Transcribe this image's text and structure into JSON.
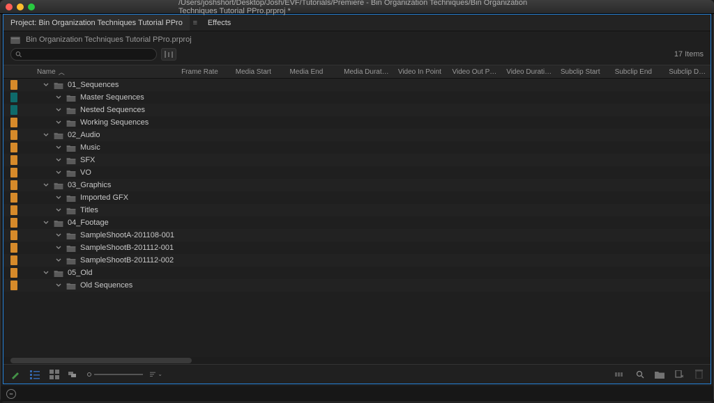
{
  "window": {
    "title": "/Users/joshshort/Desktop/Josh/EVF/Tutorials/Premiere - Bin Organization Techniques/Bin Organization Techniques Tutorial PPro.prproj *"
  },
  "panel": {
    "active_tab": "Project: Bin Organization Techniques Tutorial PPro",
    "inactive_tab": "Effects",
    "project_file": "Bin Organization Techniques Tutorial PPro.prproj",
    "search_placeholder": "",
    "item_count": "17 Items"
  },
  "columns": [
    "Name",
    "Frame Rate",
    "Media Start",
    "Media End",
    "Media Duration",
    "Video In Point",
    "Video Out Point",
    "Video Duration",
    "Subclip Start",
    "Subclip End",
    "Subclip Dura"
  ],
  "rows": [
    {
      "indent": 0,
      "chip": "orange",
      "name": "01_Sequences"
    },
    {
      "indent": 1,
      "chip": "teal",
      "name": "Master Sequences"
    },
    {
      "indent": 1,
      "chip": "teal",
      "name": "Nested Sequences"
    },
    {
      "indent": 1,
      "chip": "orange",
      "name": "Working Sequences"
    },
    {
      "indent": 0,
      "chip": "orange",
      "name": "02_Audio"
    },
    {
      "indent": 1,
      "chip": "orange",
      "name": "Music"
    },
    {
      "indent": 1,
      "chip": "orange",
      "name": "SFX"
    },
    {
      "indent": 1,
      "chip": "orange",
      "name": "VO"
    },
    {
      "indent": 0,
      "chip": "orange",
      "name": "03_Graphics"
    },
    {
      "indent": 1,
      "chip": "orange",
      "name": "Imported GFX"
    },
    {
      "indent": 1,
      "chip": "orange",
      "name": "Titles"
    },
    {
      "indent": 0,
      "chip": "orange",
      "name": "04_Footage"
    },
    {
      "indent": 1,
      "chip": "orange",
      "name": "SampleShootA-201108-001"
    },
    {
      "indent": 1,
      "chip": "orange",
      "name": "SampleShootB-201112-001"
    },
    {
      "indent": 1,
      "chip": "orange",
      "name": "SampleShootB-201112-002"
    },
    {
      "indent": 0,
      "chip": "orange",
      "name": "05_Old"
    },
    {
      "indent": 1,
      "chip": "orange",
      "name": "Old Sequences"
    }
  ]
}
